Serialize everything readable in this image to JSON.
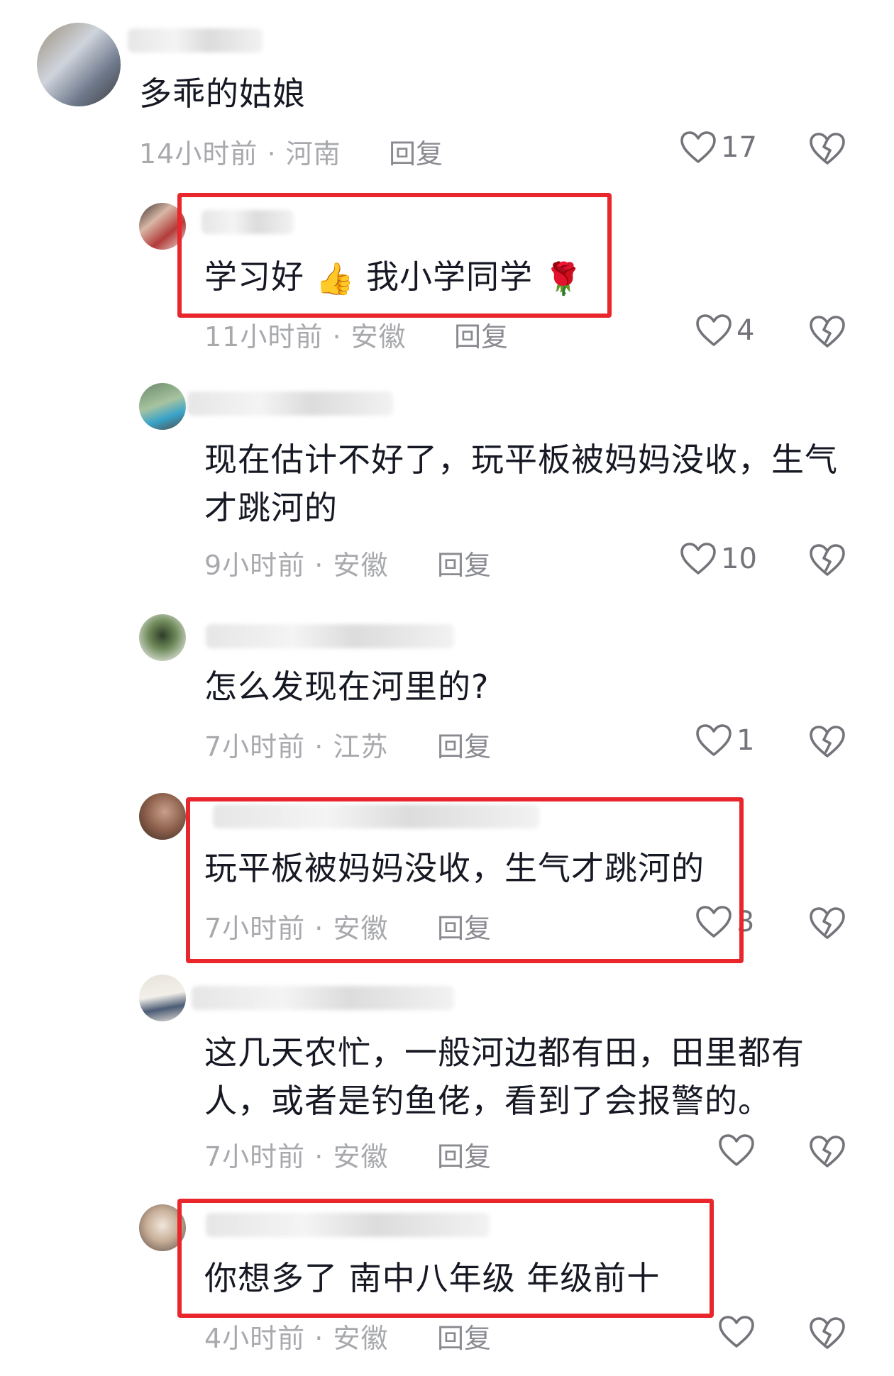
{
  "comments": [
    {
      "text": "多乖的姑娘",
      "time": "14小时前",
      "region": "河南",
      "reply": "回复",
      "likes": "17"
    },
    {
      "text_a": "学习好",
      "emoji1": "👍",
      "text_b": "我小学同学",
      "emoji2": "🌹",
      "time": "11小时前",
      "region": "安徽",
      "reply": "回复",
      "likes": "4"
    },
    {
      "line1": "现在估计不好了，玩平板被妈妈没收，生气",
      "line2": "才跳河的",
      "time": "9小时前",
      "region": "安徽",
      "reply": "回复",
      "likes": "10"
    },
    {
      "text": "怎么发现在河里的?",
      "time": "7小时前",
      "region": "江苏",
      "reply": "回复",
      "likes": "1"
    },
    {
      "text": "玩平板被妈妈没收，生气才跳河的",
      "time": "7小时前",
      "region": "安徽",
      "reply": "回复",
      "likes": "3"
    },
    {
      "line1": "这几天农忙，一般河边都有田，田里都有",
      "line2": "人，或者是钓鱼佬，看到了会报警的。",
      "time": "7小时前",
      "region": "安徽",
      "reply": "回复",
      "likes": ""
    },
    {
      "text": "你想多了 南中八年级 年级前十",
      "time": "4小时前",
      "region": "安徽",
      "reply": "回复",
      "likes": ""
    }
  ],
  "separator": "·",
  "colors": {
    "highlight": "#e8262c",
    "meta": "#a8a9ad",
    "text": "#161823"
  },
  "icons": {
    "like": "heart-outline-icon",
    "dislike": "broken-heart-icon"
  }
}
